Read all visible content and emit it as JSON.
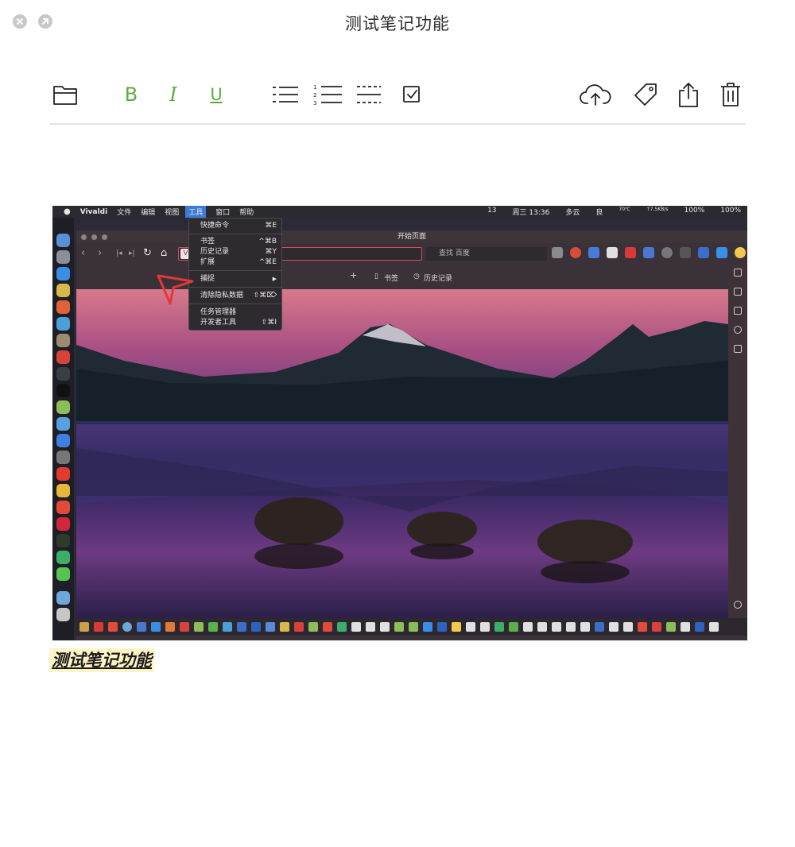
{
  "window": {
    "title": "测试笔记功能"
  },
  "toolbar": {
    "bold_label": "B",
    "italic_label": "I",
    "underline_label": "U",
    "numbered_list_digits": [
      "1",
      "2",
      "3"
    ]
  },
  "embedded_screenshot": {
    "menubar": {
      "app_name": "Vivaldi",
      "menus": [
        "文件",
        "编辑",
        "视图",
        "工具",
        "窗口",
        "帮助"
      ],
      "wechat_count": "13",
      "clock": "周三 13:36",
      "weather": "多云",
      "air": "良",
      "temp": "70℃",
      "net_up": "↑7.5KB/s",
      "fan": "1990",
      "net_down": "↓3.5KB/s",
      "brightness": "100%",
      "battery": "100%"
    },
    "browser": {
      "page_title": "开始页面",
      "search_placeholder": "查找 百度",
      "new_tab_symbol": "+",
      "speed_dial_bookmarks": "书签",
      "speed_dial_history": "历史记录"
    },
    "tools_menu": {
      "items": [
        {
          "label": "快捷命令",
          "shortcut": "⌘E"
        },
        {
          "label": "书签",
          "shortcut": "^⌘B"
        },
        {
          "label": "历史记录",
          "shortcut": "⌘Y"
        },
        {
          "label": "扩展",
          "shortcut": "^⌘E"
        },
        {
          "label": "捕捉",
          "shortcut": "▶"
        },
        {
          "label": "清除隐私数据",
          "shortcut": "⇧⌘⌦"
        },
        {
          "label": "任务管理器",
          "shortcut": ""
        },
        {
          "label": "开发者工具",
          "shortcut": "⇧⌘I"
        }
      ]
    }
  },
  "caption": {
    "text": "测试笔记功能"
  },
  "colors": {
    "format_green": "#5cab3f",
    "caption_highlight": "#fff4c6",
    "accent_red": "#d64d5b"
  }
}
